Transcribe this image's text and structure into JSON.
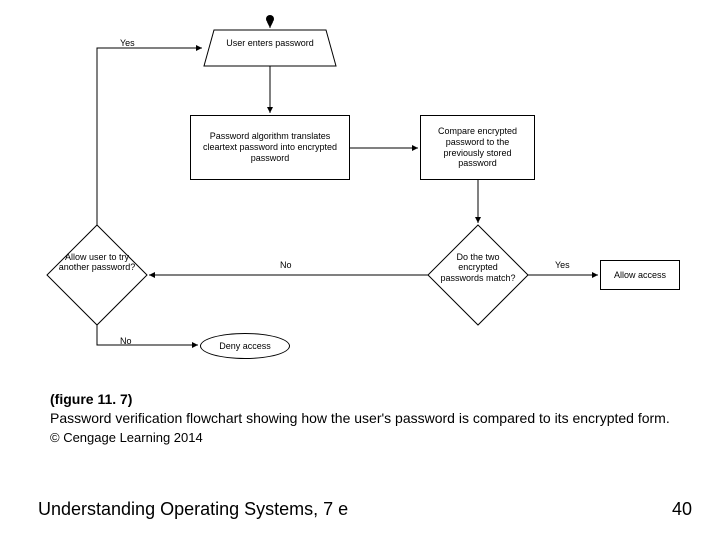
{
  "flow": {
    "input": "User enters password",
    "step_encrypt": "Password algorithm translates cleartext password into encrypted password",
    "step_compare": "Compare encrypted password to the previously stored password",
    "decision_match": "Do the two encrypted passwords match?",
    "decision_retry": "Allow user to try another password?",
    "allow": "Allow access",
    "deny": "Deny access",
    "yes": "Yes",
    "no": "No"
  },
  "caption": {
    "figure": "(figure 11. 7)",
    "text": "Password verification flowchart showing how the user's password is compared to its encrypted form.",
    "copyright": "© Cengage Learning 2014"
  },
  "footer": {
    "title": "Understanding Operating Systems, 7 e",
    "page": "40"
  },
  "chart_data": {
    "type": "flowchart",
    "nodes": [
      {
        "id": "start",
        "type": "start-dot"
      },
      {
        "id": "input",
        "type": "manual-input",
        "text": "User enters password"
      },
      {
        "id": "encrypt",
        "type": "process",
        "text": "Password algorithm translates cleartext password into encrypted password"
      },
      {
        "id": "compare",
        "type": "process",
        "text": "Compare encrypted password to the previously stored password"
      },
      {
        "id": "match",
        "type": "decision",
        "text": "Do the two encrypted passwords match?"
      },
      {
        "id": "allow",
        "type": "process",
        "text": "Allow access"
      },
      {
        "id": "retry",
        "type": "decision",
        "text": "Allow user to try another password?"
      },
      {
        "id": "deny",
        "type": "terminator",
        "text": "Deny access"
      }
    ],
    "edges": [
      {
        "from": "start",
        "to": "input"
      },
      {
        "from": "input",
        "to": "encrypt"
      },
      {
        "from": "encrypt",
        "to": "compare"
      },
      {
        "from": "compare",
        "to": "match"
      },
      {
        "from": "match",
        "to": "allow",
        "label": "Yes"
      },
      {
        "from": "match",
        "to": "retry",
        "label": "No"
      },
      {
        "from": "retry",
        "to": "input",
        "label": "Yes"
      },
      {
        "from": "retry",
        "to": "deny",
        "label": "No"
      }
    ]
  }
}
